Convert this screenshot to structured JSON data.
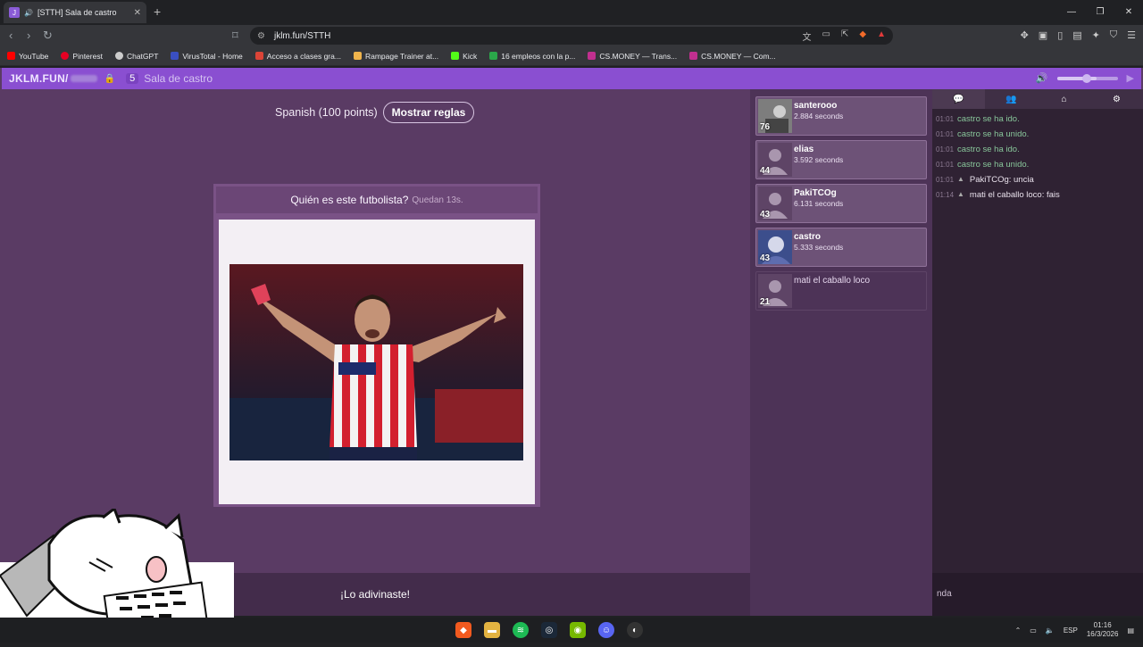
{
  "browser": {
    "tab_title": "[STTH] Sala de castro",
    "url": "jklm.fun/STTH",
    "bookmarks": [
      "YouTube",
      "Pinterest",
      "ChatGPT",
      "VirusTotal - Home",
      "Acceso a clases gra...",
      "Rampage Trainer at...",
      "Kick",
      "16 empleos con la p...",
      "CS.MONEY — Trans...",
      "CS.MONEY — Com..."
    ]
  },
  "app": {
    "logo": "JKLM.FUN/",
    "player_count": "5",
    "room_name": "Sala de castro"
  },
  "game": {
    "language": "Spanish (100 points)",
    "rules_button": "Mostrar reglas",
    "question": "Quién es este futbolista?",
    "time_left": "Quedan 13s.",
    "result": "¡Lo adivinaste!"
  },
  "players": [
    {
      "name": "santerooo",
      "time": "2.884 seconds",
      "score": "76"
    },
    {
      "name": "elias",
      "time": "3.592 seconds",
      "score": "44"
    },
    {
      "name": "PakiTCOg",
      "time": "6.131 seconds",
      "score": "43"
    },
    {
      "name": "castro",
      "time": "5.333 seconds",
      "score": "43"
    },
    {
      "name": "mati el caballo loco",
      "time": "",
      "score": "21"
    }
  ],
  "chat": {
    "messages": [
      {
        "time": "01:01",
        "text": "castro se ha ido."
      },
      {
        "time": "01:01",
        "text": "castro se ha unido."
      },
      {
        "time": "01:01",
        "text": "castro se ha ido."
      },
      {
        "time": "01:01",
        "text": "castro se ha unido."
      },
      {
        "time": "01:01",
        "text": "PakiTCOg: uncia"
      },
      {
        "time": "01:14",
        "text": "mati el caballo loco: fais"
      }
    ],
    "input_value": "nda"
  },
  "taskbar": {
    "lang": "ESP",
    "time": "01:16",
    "date": "16/3/2026"
  }
}
